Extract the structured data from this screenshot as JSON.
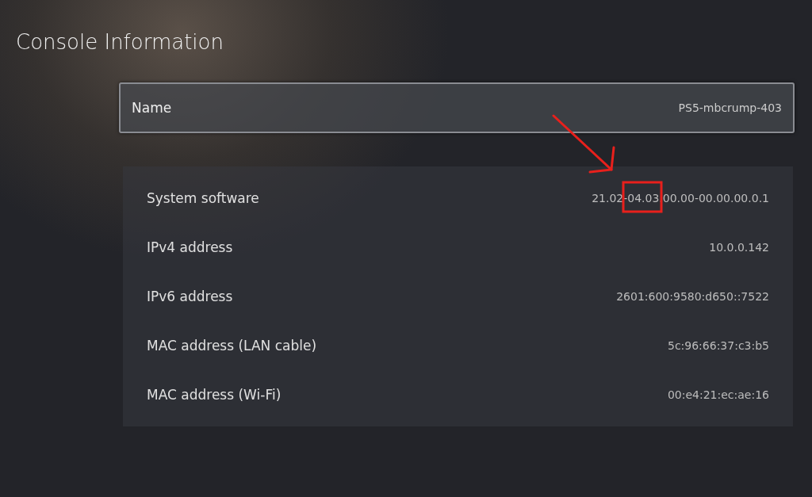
{
  "title": "Console Information",
  "name_field": {
    "label": "Name",
    "value": "PS5-mbcrump-403",
    "selected": true
  },
  "info_rows": [
    {
      "label": "System software",
      "value": "21.02-04.03.00.00-00.00.00.0.1"
    },
    {
      "label": "IPv4 address",
      "value": "10.0.0.142"
    },
    {
      "label": "IPv6 address",
      "value": "2601:600:9580:d650::7522"
    },
    {
      "label": "MAC address (LAN cable)",
      "value": "5c:96:66:37:c3:b5"
    },
    {
      "label": "MAC address (Wi-Fi)",
      "value": "00:e4:21:ec:ae:16"
    }
  ]
}
